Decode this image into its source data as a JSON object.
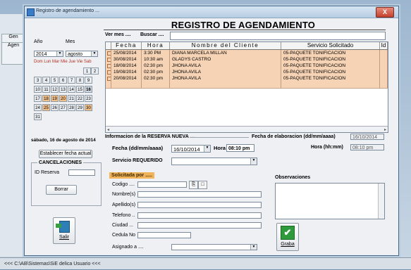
{
  "window": {
    "title": "Registro de agendamiento ...",
    "close": "X"
  },
  "background": {
    "tab1": "Gen",
    "tab2": "Agen",
    "status": "<<< C:\\AB\\Sistemas\\SiE delica    Usuario <<<"
  },
  "heading": "REGISTRO DE AGENDAMIENTO",
  "search": {
    "vermes_label": "Ver mes ....",
    "buscar_label": "Buscar ....",
    "buscar_value": ""
  },
  "calendar": {
    "year_label": "Año",
    "month_label": "Mes",
    "year_value": "2014",
    "month_value": "agosto",
    "daynames": "Dom Lun Mar Mie Jue Vie Sab",
    "days": [
      {
        "d": "1",
        "hl": false
      },
      {
        "d": "2",
        "hl": false
      },
      {
        "d": "3",
        "hl": false
      },
      {
        "d": "4",
        "hl": false
      },
      {
        "d": "5",
        "hl": false
      },
      {
        "d": "6",
        "hl": false
      },
      {
        "d": "7",
        "hl": false
      },
      {
        "d": "8",
        "hl": false
      },
      {
        "d": "9",
        "hl": false
      },
      {
        "d": "10",
        "hl": false
      },
      {
        "d": "11",
        "hl": false
      },
      {
        "d": "12",
        "hl": false
      },
      {
        "d": "13",
        "hl": false
      },
      {
        "d": "14",
        "hl": false
      },
      {
        "d": "15",
        "hl": false
      },
      {
        "d": "16",
        "hl": false,
        "sel": true
      },
      {
        "d": "17",
        "hl": false
      },
      {
        "d": "18",
        "hl": true
      },
      {
        "d": "19",
        "hl": true
      },
      {
        "d": "20",
        "hl": true
      },
      {
        "d": "21",
        "hl": false
      },
      {
        "d": "22",
        "hl": false
      },
      {
        "d": "23",
        "hl": false
      },
      {
        "d": "24",
        "hl": false
      },
      {
        "d": "25",
        "hl": true
      },
      {
        "d": "26",
        "hl": false
      },
      {
        "d": "27",
        "hl": false
      },
      {
        "d": "28",
        "hl": false
      },
      {
        "d": "29",
        "hl": false
      },
      {
        "d": "30",
        "hl": true
      },
      {
        "d": "31",
        "hl": false
      }
    ],
    "date_long": "sábado, 16 de agosto de 2014",
    "set_date_button": "Establecer fecha actual"
  },
  "cancel": {
    "title": "CANCELACIONES",
    "id_label": "ID Reserva",
    "id_value": "",
    "delete_button": "Borrar"
  },
  "salir_label": "Salir",
  "table": {
    "headers": [
      "",
      "Fecha",
      "Hora",
      "Nombre del Cliente",
      "Servicio Solicitado",
      "Id"
    ],
    "rows": [
      [
        "25/08/2014",
        "3:30 PM",
        "DIANA MARCELA MILLAN",
        "05-PAQUETE TONIFICACION",
        ""
      ],
      [
        "30/08/2014",
        "10:30 am",
        "GLADYS CASTRO",
        "05-PAQUETE TONIFICACION",
        ""
      ],
      [
        "18/08/2014",
        "02:30 pm",
        "JHONA AVILA",
        "05-PAQUETE TONIFICACION",
        ""
      ],
      [
        "19/08/2014",
        "02:30 pm",
        "JHONA AVILA",
        "05-PAQUETE TONIFICACION",
        ""
      ],
      [
        "20/08/2014",
        "02:30 pm",
        "JHONA AVILA",
        "05-PAQUETE TONIFICACION",
        ""
      ]
    ]
  },
  "form": {
    "section_title": "Informacion de la RESERVA NUEVA ....",
    "elab_label": "Fecha de elaboracion (dd/mm/aaaa)",
    "elab_value": "16/10/2014",
    "fecha_label": "Fecha (dd/mm/aaaa)",
    "fecha_value": "16/10/2014",
    "hora_label": "Hora",
    "hora_value": "08:10 pm",
    "hora2_label": "Hora (hh:mm)",
    "hora2_value": "08:10 pm",
    "servicio_label": "Servicio REQUERIDO",
    "servicio_value": "",
    "solicitada_label": "Solicitada por .....",
    "codigo_label": "Codigo ....",
    "nombres_label": "Nombre(s)",
    "apellidos_label": "Apellido(s)",
    "telefono_label": "Telefono ..",
    "ciudad_label": "Ciudad ...",
    "cedula_label": "Cedula No",
    "asignado_label": "Asignado a ....",
    "obs_label": "Observaciones",
    "grabar_label": "Graba"
  }
}
